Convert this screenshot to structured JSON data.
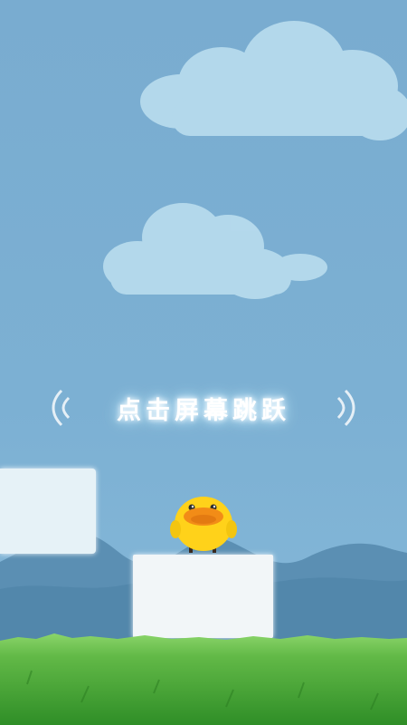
{
  "hint": {
    "text": "点击屏幕跳跃"
  },
  "icons": {
    "left_wave": "sound-wave-left-icon",
    "right_wave": "sound-wave-right-icon"
  },
  "colors": {
    "sky": "#79acd0",
    "cloud": "#b8dbec",
    "hills": "#5d8fb3",
    "grass": "#4fae3a",
    "platform": "#f2f6f8",
    "chick": "#ffd21a",
    "beak": "#f08a16"
  }
}
